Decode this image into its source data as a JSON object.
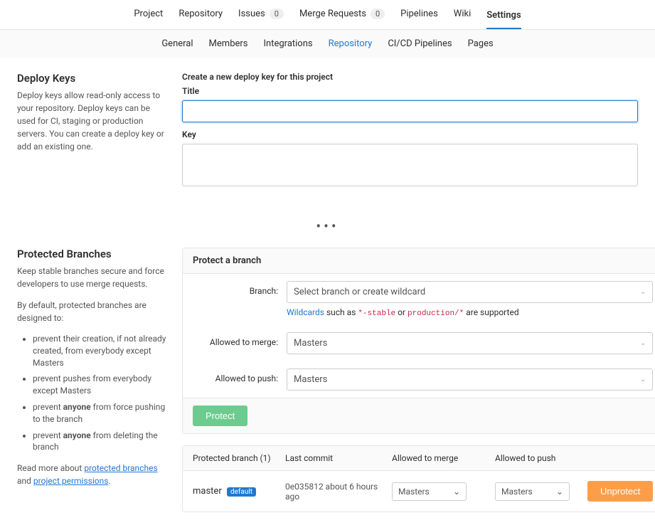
{
  "topnav": {
    "project": "Project",
    "repository": "Repository",
    "issues": "Issues",
    "issues_count": "0",
    "merge_requests": "Merge Requests",
    "merge_requests_count": "0",
    "pipelines": "Pipelines",
    "wiki": "Wiki",
    "settings": "Settings"
  },
  "subnav": {
    "general": "General",
    "members": "Members",
    "integrations": "Integrations",
    "repository": "Repository",
    "cicd": "CI/CD Pipelines",
    "pages": "Pages"
  },
  "deploy": {
    "title": "Deploy Keys",
    "desc": "Deploy keys allow read-only access to your repository. Deploy keys can be used for CI, staging or production servers. You can create a deploy key or add an existing one.",
    "form_heading": "Create a new deploy key for this project",
    "title_label": "Title",
    "key_label": "Key"
  },
  "protected": {
    "title": "Protected Branches",
    "desc1": "Keep stable branches secure and force developers to use merge requests.",
    "desc2": "By default, protected branches are designed to:",
    "li1_a": "prevent their creation, if not already created, from everybody except Masters",
    "li2_a": "prevent pushes from everybody except Masters",
    "li3_a": "prevent ",
    "li3_b": "anyone",
    "li3_c": " from force pushing to the branch",
    "li4_a": "prevent ",
    "li4_b": "anyone",
    "li4_c": " from deleting the branch",
    "read_more_a": "Read more about ",
    "link1": "protected branches",
    "read_more_b": " and ",
    "link2": "project permissions",
    "read_more_c": ".",
    "panel_head": "Protect a branch",
    "branch_label": "Branch:",
    "branch_placeholder": "Select branch or create wildcard",
    "hint_word": "Wildcards",
    "hint_mid1": " such as ",
    "hint_code1": "*-stable",
    "hint_mid2": " or ",
    "hint_code2": "production/*",
    "hint_end": " are supported",
    "merge_label": "Allowed to merge:",
    "merge_value": "Masters",
    "push_label": "Allowed to push:",
    "push_value": "Masters",
    "protect_btn": "Protect"
  },
  "table": {
    "header_branch": "Protected branch (1)",
    "header_commit": "Last commit",
    "header_merge": "Allowed to merge",
    "header_push": "Allowed to push",
    "row": {
      "branch": "master",
      "tag": "default",
      "commit": "0e035812 about 6 hours ago",
      "merge": "Masters",
      "push": "Masters",
      "unprotect": "Unprotect"
    }
  },
  "glyph": {
    "chev": "⌄"
  }
}
